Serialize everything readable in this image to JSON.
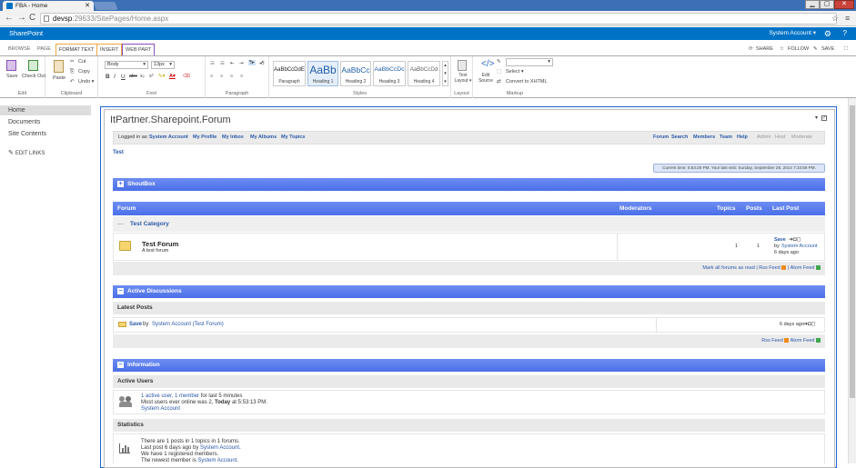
{
  "browser": {
    "tab_title": "FBA - Home",
    "url_host": "devsp",
    "url_path": ":29633/SitePages/Home.aspx"
  },
  "suitebar": {
    "brand": "SharePoint",
    "account": "System Account ▾"
  },
  "ribbon": {
    "tabs": [
      "BROWSE",
      "PAGE",
      "FORMAT TEXT",
      "INSERT",
      "WEB PART"
    ],
    "actions": {
      "share": "SHARE",
      "follow": "FOLLOW",
      "save": "SAVE"
    },
    "edit": {
      "save": "Save",
      "checkout": "Check Out",
      "label": "Edit"
    },
    "clipboard": {
      "paste": "Paste",
      "cut": "Cut",
      "copy": "Copy",
      "undo": "Undo ▾",
      "label": "Clipboard"
    },
    "font": {
      "family": "Body",
      "size": "13px",
      "label": "Font"
    },
    "paragraph": {
      "label": "Paragraph"
    },
    "styles": {
      "items": [
        {
          "sample": "AaBbCcDdE",
          "name": "Paragraph"
        },
        {
          "sample": "AaBb",
          "name": "Heading 1"
        },
        {
          "sample": "AaBbCc",
          "name": "Heading 2"
        },
        {
          "sample": "AaBbCcDc",
          "name": "Heading 3"
        },
        {
          "sample": "AaBbCcDd",
          "name": "Heading 4"
        }
      ],
      "label": "Styles"
    },
    "layout": {
      "text_layout": "Text Layout ▾",
      "label": "Layout"
    },
    "markup": {
      "edit_source": "Edit Source",
      "select": "Select ▾",
      "convert": "Convert to XHTML",
      "label": "Markup"
    }
  },
  "leftnav": {
    "items": [
      "Home",
      "Documents",
      "Site Contents"
    ],
    "edit_links": "EDIT LINKS"
  },
  "webpart": {
    "title": "ItPartner.Sharepoint.Forum"
  },
  "forum": {
    "logged_prefix": "Logged in as:",
    "user": "System Account",
    "user_links": [
      "My Profile",
      "My Inbox",
      "My Albums",
      "My Topics"
    ],
    "nav_links": [
      "Forum",
      "Search",
      "Members",
      "Team",
      "Help"
    ],
    "nav_disabled": [
      "Admin",
      "Host",
      "Moderate"
    ],
    "breadcrumb": "Test",
    "time_info": "Current time: 5:54:28 PM. Your last visit: Sunday, September 28, 2014 7:10:58 PM.",
    "shoutbox": "ShoutBox",
    "table_headers": {
      "forum": "Forum",
      "moderators": "Moderators",
      "topics": "Topics",
      "posts": "Posts",
      "last_post": "Last Post"
    },
    "category": "Test Category",
    "forum_row": {
      "name": "Test Forum",
      "description": "A test forum",
      "topics": "1",
      "posts": "1",
      "last_post_title": "Save",
      "last_post_by": "by",
      "last_post_user": "System Account",
      "last_post_time": "6 days ago"
    },
    "mark_read": "Mark all forums as read",
    "rss": "Rss Feed",
    "atom": "Atom Feed",
    "active_discussions": "Active Discussions",
    "latest_posts": "Latest Posts",
    "latest_post": {
      "title": "Save",
      "by": "by",
      "user": "System Account (Test Forum)",
      "time": "6 days ago"
    },
    "information": "Information",
    "active_users": "Active Users",
    "active_users_line1_link": "1 active user, 1 member",
    "active_users_line1_rest": " for last 5 minutes",
    "active_users_line2_a": "Most users ever online was 2, ",
    "active_users_line2_b": "Today",
    "active_users_line2_c": " at 5:53:13 PM.",
    "active_users_line3": "System Account",
    "statistics": "Statistics",
    "stats_line1": "There are 1 posts in 1 topics in 1 forums.",
    "stats_line2_a": "Last post 6 days ago by ",
    "stats_line2_b": "System Account",
    "stats_line3": "We have 1 registered members.",
    "stats_line4_a": "The newest member is ",
    "stats_line4_b": "System Account"
  }
}
